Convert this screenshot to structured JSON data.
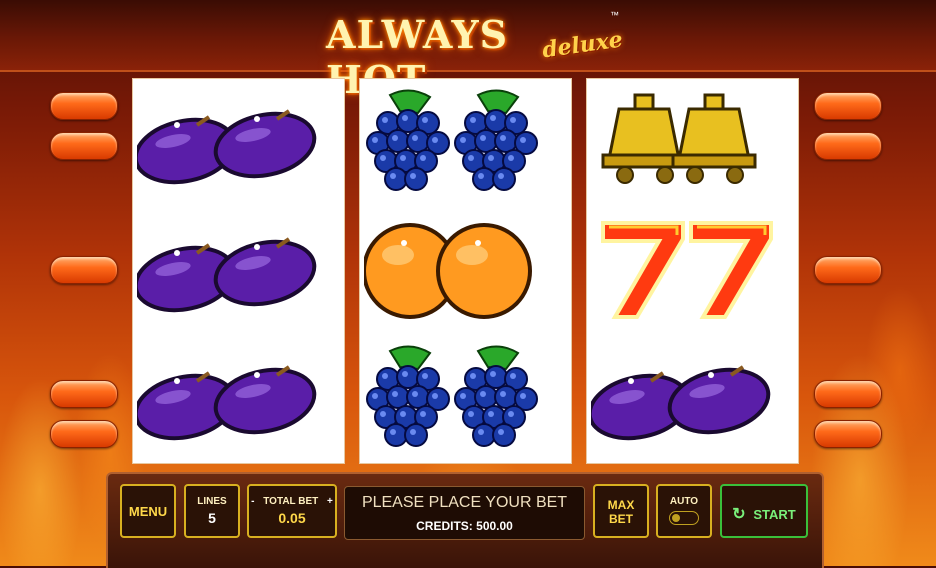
{
  "game": {
    "title": "ALWAYS HOT",
    "subtitle": "deluxe",
    "trademark": "™"
  },
  "reels": [
    [
      "plum",
      "plum",
      "plum"
    ],
    [
      "grapes",
      "orange",
      "grapes"
    ],
    [
      "bell",
      "seven",
      "plum"
    ]
  ],
  "controls": {
    "menu_label": "MENU",
    "lines_label": "LINES",
    "lines_value": "5",
    "total_bet_label": "TOTAL BET",
    "total_bet_minus": "-",
    "total_bet_plus": "+",
    "total_bet_value": "0.05",
    "message": "PLEASE PLACE YOUR BET",
    "credits": "CREDITS: 500.00",
    "max_bet_line1": "MAX",
    "max_bet_line2": "BET",
    "auto_label": "AUTO",
    "start_label": "START"
  },
  "colors": {
    "accent_gold": "#d8b020",
    "start_green": "#3ac03a",
    "plum": "#5a1ea8",
    "grape": "#1a3aa8",
    "orange": "#ff9a20"
  }
}
